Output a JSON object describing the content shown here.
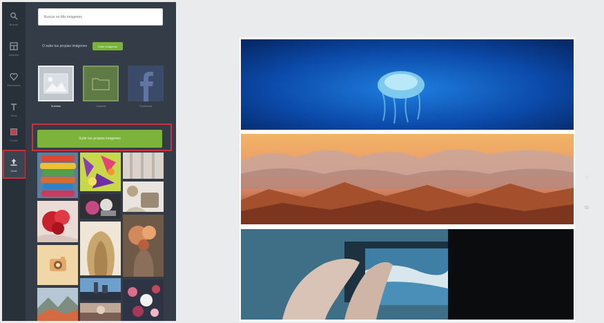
{
  "rail": {
    "items": [
      {
        "id": "search",
        "label": "Buscar",
        "icon": "search-icon"
      },
      {
        "id": "layouts",
        "label": "Diseños",
        "icon": "layouts-icon"
      },
      {
        "id": "elements",
        "label": "Elementos",
        "icon": "elements-icon"
      },
      {
        "id": "text",
        "label": "Texto",
        "icon": "text-icon"
      },
      {
        "id": "background",
        "label": "Fondo",
        "icon": "background-icon"
      },
      {
        "id": "uploads",
        "label": "Subir",
        "icon": "uploads-icon",
        "active": true
      }
    ]
  },
  "panel": {
    "search_placeholder": "Buscar en Mis imágenes",
    "upload_text": "O sube tus propias imágenes",
    "upload_button": "Subir imágenes",
    "sources": [
      {
        "label": "Subidas",
        "icon": "image-placeholder-icon"
      },
      {
        "label": "Carpeta",
        "icon": "folder-icon"
      },
      {
        "label": "Facebook",
        "icon": "facebook-icon"
      }
    ],
    "cta_label": "Subir tus propias imágenes"
  },
  "colors": {
    "accent_green": "#7cb33a",
    "highlight_red": "#c8313f",
    "rail_bg": "#28303a",
    "panel_bg": "#333c47"
  }
}
